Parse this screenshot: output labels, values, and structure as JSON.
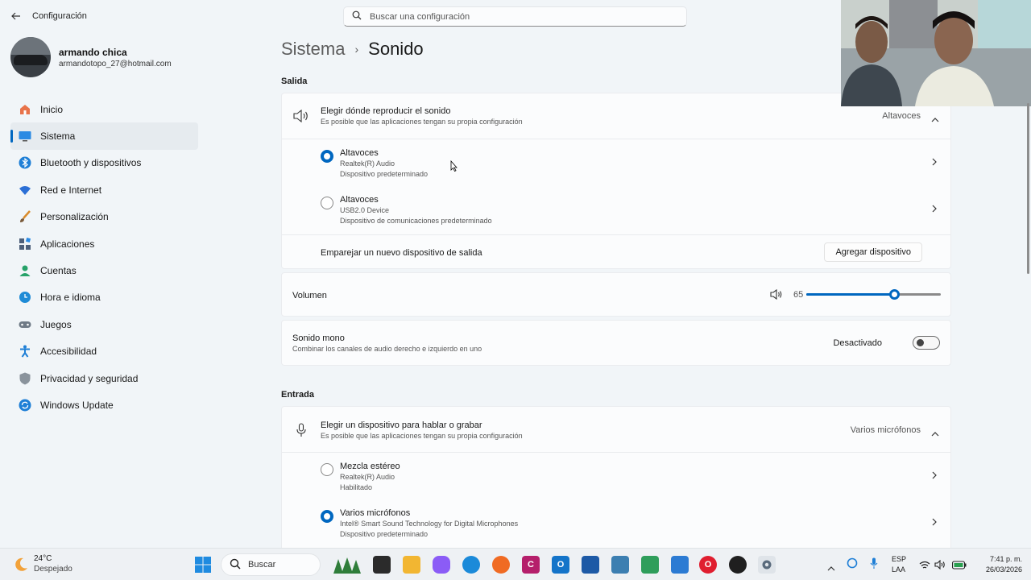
{
  "app": {
    "title": "Configuración",
    "back_label": "←"
  },
  "profile": {
    "name": "armando chica",
    "email": "armandotopo_27@hotmail.com"
  },
  "search": {
    "placeholder": "Buscar una configuración"
  },
  "breadcrumb": {
    "parent": "Sistema",
    "separator": "›",
    "current": "Sonido"
  },
  "nav": {
    "items": [
      {
        "label": "Inicio",
        "icon": "home-icon",
        "color": "#e35a2b"
      },
      {
        "label": "Sistema",
        "icon": "monitor-icon",
        "color": "#2b8ae3"
      },
      {
        "label": "Bluetooth y dispositivos",
        "icon": "bluetooth-icon",
        "color": "#1f7fd6"
      },
      {
        "label": "Red e Internet",
        "icon": "wifi-icon",
        "color": "#2b6fd6"
      },
      {
        "label": "Personalización",
        "icon": "brush-icon",
        "color": "#d98b2b"
      },
      {
        "label": "Aplicaciones",
        "icon": "apps-icon",
        "color": "#4d5f7a"
      },
      {
        "label": "Cuentas",
        "icon": "person-icon",
        "color": "#26a269"
      },
      {
        "label": "Hora e idioma",
        "icon": "globe-clock-icon",
        "color": "#1f8bd6"
      },
      {
        "label": "Juegos",
        "icon": "gamepad-icon",
        "color": "#6f7a86"
      },
      {
        "label": "Accesibilidad",
        "icon": "accessibility-icon",
        "color": "#1f7fd6"
      },
      {
        "label": "Privacidad y seguridad",
        "icon": "shield-icon",
        "color": "#707a84"
      },
      {
        "label": "Windows Update",
        "icon": "update-icon",
        "color": "#1f7fd6"
      }
    ]
  },
  "output": {
    "section_label": "Salida",
    "choose": {
      "title": "Elegir dónde reproducir el sonido",
      "subtitle": "Es posible que las aplicaciones tengan su propia configuración",
      "value": "Altavoces"
    },
    "devices": [
      {
        "name": "Altavoces",
        "line1": "Realtek(R) Audio",
        "line2": "Dispositivo predeterminado",
        "selected": true
      },
      {
        "name": "Altavoces",
        "line1": "USB2.0 Device",
        "line2": "Dispositivo de comunicaciones predeterminado",
        "selected": false
      }
    ],
    "pair": {
      "label": "Emparejar un nuevo dispositivo de salida",
      "button": "Agregar dispositivo"
    }
  },
  "volume": {
    "label": "Volumen",
    "value": "65",
    "level": 0.65
  },
  "mono": {
    "title": "Sonido mono",
    "subtitle": "Combinar los canales de audio derecho e izquierdo en uno",
    "state": "Desactivado"
  },
  "input": {
    "section_label": "Entrada",
    "choose": {
      "title": "Elegir un dispositivo para hablar o grabar",
      "subtitle": "Es posible que las aplicaciones tengan su propia configuración",
      "value": "Varios micrófonos"
    },
    "devices": [
      {
        "name": "Mezcla estéreo",
        "line1": "Realtek(R) Audio",
        "line2": "Habilitado",
        "selected": false
      },
      {
        "name": "Varios micrófonos",
        "line1": "Intel® Smart Sound Technology for Digital Microphones",
        "line2": "Dispositivo predeterminado",
        "selected": true
      }
    ]
  },
  "taskbar": {
    "weather_temp": "24°C",
    "weather_desc": "Despejado",
    "search_label": "Buscar",
    "lang_top": "ESP",
    "lang_bottom": "LAA",
    "time": "7:41 p. m.",
    "date": "26/03/2026"
  }
}
